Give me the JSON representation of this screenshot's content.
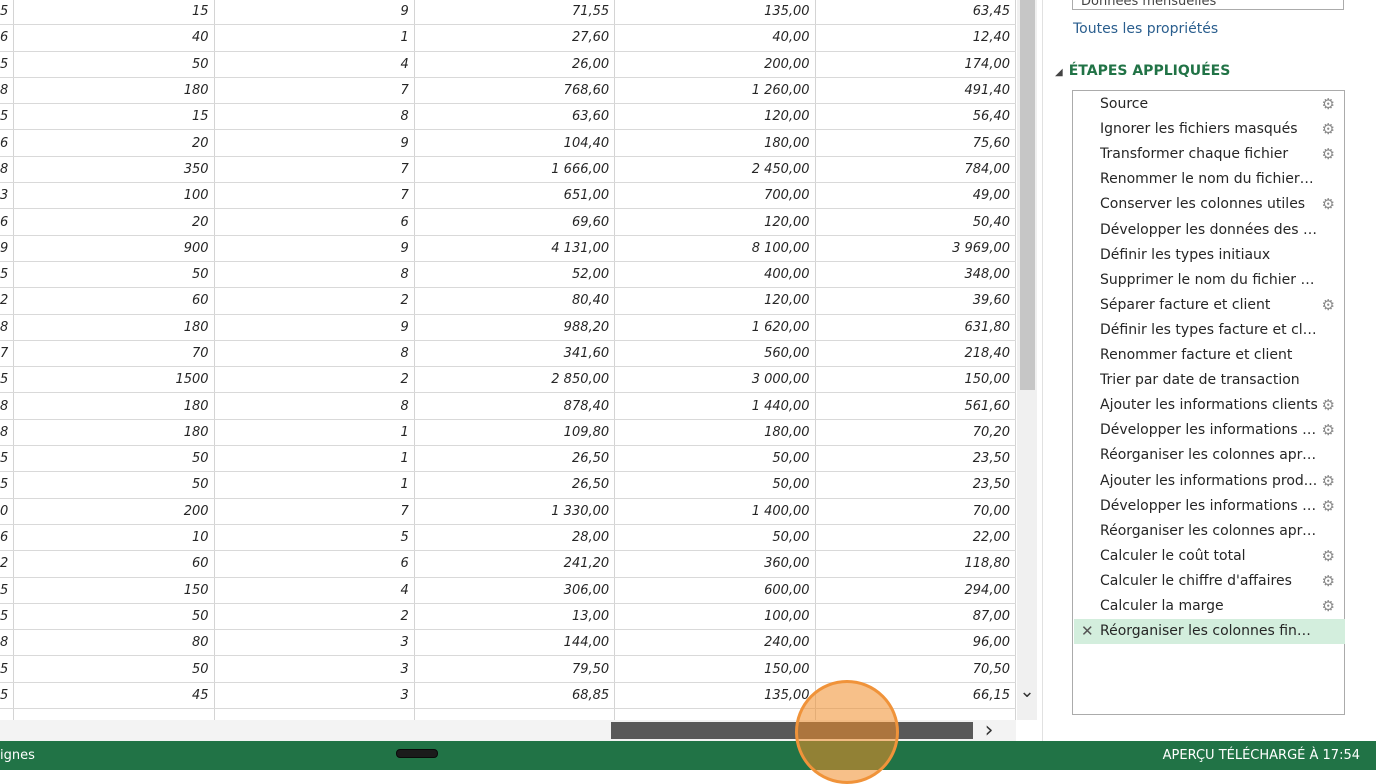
{
  "grid": {
    "rows": [
      [
        "5",
        "15",
        "9",
        "71,55",
        "135,00",
        "63,45"
      ],
      [
        "6",
        "40",
        "1",
        "27,60",
        "40,00",
        "12,40"
      ],
      [
        "5",
        "50",
        "4",
        "26,00",
        "200,00",
        "174,00"
      ],
      [
        "8",
        "180",
        "7",
        "768,60",
        "1 260,00",
        "491,40"
      ],
      [
        "5",
        "15",
        "8",
        "63,60",
        "120,00",
        "56,40"
      ],
      [
        "6",
        "20",
        "9",
        "104,40",
        "180,00",
        "75,60"
      ],
      [
        "8",
        "350",
        "7",
        "1 666,00",
        "2 450,00",
        "784,00"
      ],
      [
        "3",
        "100",
        "7",
        "651,00",
        "700,00",
        "49,00"
      ],
      [
        "6",
        "20",
        "6",
        "69,60",
        "120,00",
        "50,40"
      ],
      [
        "9",
        "900",
        "9",
        "4 131,00",
        "8 100,00",
        "3 969,00"
      ],
      [
        "5",
        "50",
        "8",
        "52,00",
        "400,00",
        "348,00"
      ],
      [
        "2",
        "60",
        "2",
        "80,40",
        "120,00",
        "39,60"
      ],
      [
        "8",
        "180",
        "9",
        "988,20",
        "1 620,00",
        "631,80"
      ],
      [
        "7",
        "70",
        "8",
        "341,60",
        "560,00",
        "218,40"
      ],
      [
        "5",
        "1500",
        "2",
        "2 850,00",
        "3 000,00",
        "150,00"
      ],
      [
        "8",
        "180",
        "8",
        "878,40",
        "1 440,00",
        "561,60"
      ],
      [
        "8",
        "180",
        "1",
        "109,80",
        "180,00",
        "70,20"
      ],
      [
        "5",
        "50",
        "1",
        "26,50",
        "50,00",
        "23,50"
      ],
      [
        "5",
        "50",
        "1",
        "26,50",
        "50,00",
        "23,50"
      ],
      [
        "0",
        "200",
        "7",
        "1 330,00",
        "1 400,00",
        "70,00"
      ],
      [
        "6",
        "10",
        "5",
        "28,00",
        "50,00",
        "22,00"
      ],
      [
        "2",
        "60",
        "6",
        "241,20",
        "360,00",
        "118,80"
      ],
      [
        "5",
        "150",
        "4",
        "306,00",
        "600,00",
        "294,00"
      ],
      [
        "5",
        "50",
        "2",
        "13,00",
        "100,00",
        "87,00"
      ],
      [
        "8",
        "80",
        "3",
        "144,00",
        "240,00",
        "96,00"
      ],
      [
        "5",
        "50",
        "3",
        "79,50",
        "150,00",
        "70,50"
      ],
      [
        "5",
        "45",
        "3",
        "68,85",
        "135,00",
        "66,15"
      ],
      [
        "",
        "",
        "",
        "",
        "",
        ""
      ]
    ]
  },
  "query_settings": {
    "name_field_value": "Données mensuelles",
    "all_properties_link": "Toutes les propriétés",
    "applied_steps_title": "ÉTAPES APPLIQUÉES",
    "steps": [
      {
        "label": "Source",
        "gear": true
      },
      {
        "label": "Ignorer les fichiers masqués",
        "gear": true
      },
      {
        "label": "Transformer chaque fichier",
        "gear": true
      },
      {
        "label": "Renommer le nom du fichier s...",
        "gear": false
      },
      {
        "label": "Conserver les colonnes utiles",
        "gear": true
      },
      {
        "label": "Développer les données des fi...",
        "gear": false
      },
      {
        "label": "Définir les types initiaux",
        "gear": false
      },
      {
        "label": "Supprimer le nom du fichier s...",
        "gear": false
      },
      {
        "label": "Séparer facture et client",
        "gear": true
      },
      {
        "label": "Définir les types facture et client",
        "gear": false
      },
      {
        "label": "Renommer facture et client",
        "gear": false
      },
      {
        "label": "Trier par date de transaction",
        "gear": false
      },
      {
        "label": "Ajouter les informations clients",
        "gear": true
      },
      {
        "label": "Développer les informations cl...",
        "gear": true
      },
      {
        "label": "Réorganiser les colonnes aprè...",
        "gear": false
      },
      {
        "label": "Ajouter les informations prod...",
        "gear": true
      },
      {
        "label": "Développer les informations p...",
        "gear": true
      },
      {
        "label": "Réorganiser les colonnes aprè...",
        "gear": false
      },
      {
        "label": "Calculer le coût total",
        "gear": true
      },
      {
        "label": "Calculer le chiffre d'affaires",
        "gear": true
      },
      {
        "label": "Calculer la marge",
        "gear": true
      },
      {
        "label": "Réorganiser les colonnes finales",
        "gear": false,
        "active": true
      }
    ]
  },
  "status": {
    "left_text": "ignes",
    "right_text": "APERÇU TÉLÉCHARGÉ À 17:54"
  },
  "icons": {
    "gear": "⚙",
    "delete": "✕",
    "collapse": "◢",
    "scroll_down": "⌄",
    "scroll_right": "›"
  },
  "colors": {
    "status_bar": "#217346",
    "accent_header": "#217346",
    "active_step": "#d3eedd",
    "link": "#2a5e8e"
  }
}
